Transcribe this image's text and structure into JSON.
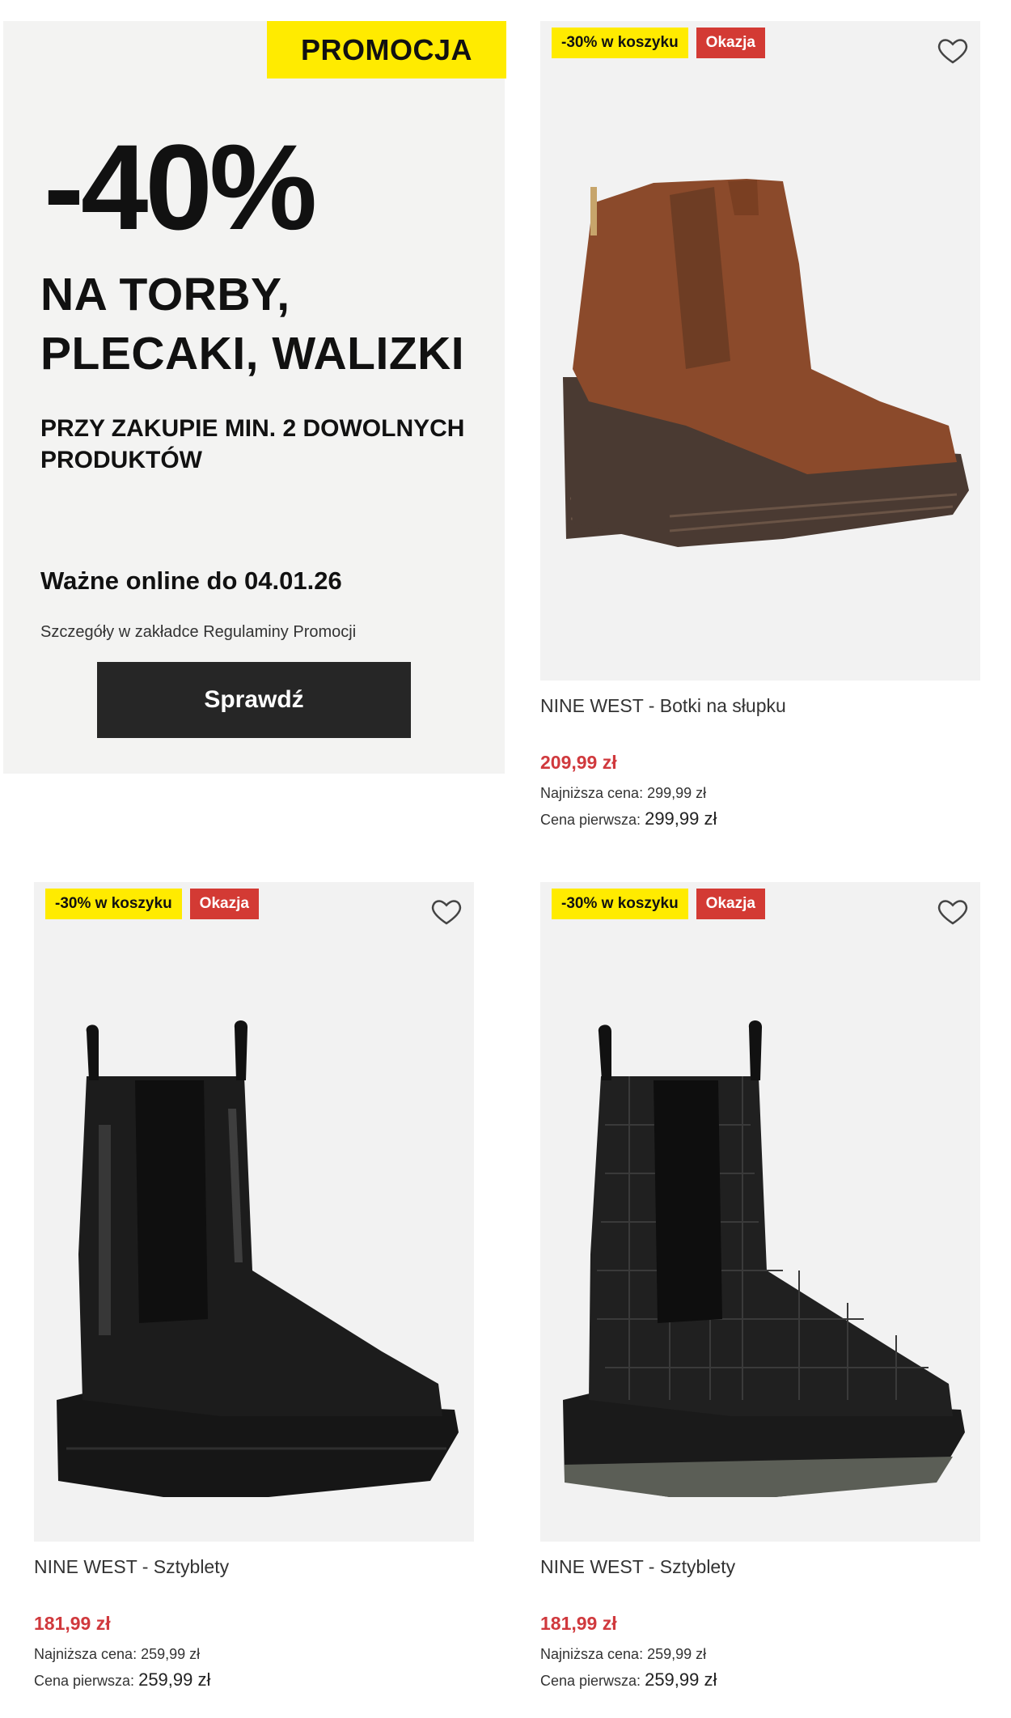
{
  "promo": {
    "tag": "PROMOCJA",
    "percent": "-40%",
    "headline_1": "NA TORBY,",
    "headline_2": "PLECAKI, WALIZKI",
    "sub_1": "PRZY ZAKUPIE MIN. 2 DOWOLNYCH",
    "sub_2": "PRODUKTÓW",
    "valid": "Ważne online do 04.01.26",
    "details": "Szczegóły w zakładce Regulaminy Promocji",
    "button": "Sprawdź"
  },
  "products": [
    {
      "badge_discount": "-30% w koszyku",
      "badge_deal": "Okazja",
      "title": "NINE WEST - Botki na słupku",
      "price": "209,99 zł",
      "lowest_label": "Najniższa cena:",
      "lowest_value": "299,99 zł",
      "first_label": "Cena pierwsza:",
      "first_value": "299,99 zł",
      "image": "brown-suede-heeled-chelsea-boot"
    },
    {
      "badge_discount": "-30% w koszyku",
      "badge_deal": "Okazja",
      "title": "NINE WEST - Sztyblety",
      "price": "181,99 zł",
      "lowest_label": "Najniższa cena:",
      "lowest_value": "259,99 zł",
      "first_label": "Cena pierwsza:",
      "first_value": "259,99 zł",
      "image": "black-patent-chelsea-boot"
    },
    {
      "badge_discount": "-30% w koszyku",
      "badge_deal": "Okazja",
      "title": "NINE WEST - Sztyblety",
      "price": "181,99 zł",
      "lowest_label": "Najniższa cena:",
      "lowest_value": "259,99 zł",
      "first_label": "Cena pierwsza:",
      "first_value": "259,99 zł",
      "image": "black-croc-chelsea-boot"
    }
  ],
  "colors": {
    "promo_yellow": "#ffeb00",
    "deal_red": "#d33a34",
    "price_red": "#d0393d",
    "button_dark": "#262626"
  }
}
